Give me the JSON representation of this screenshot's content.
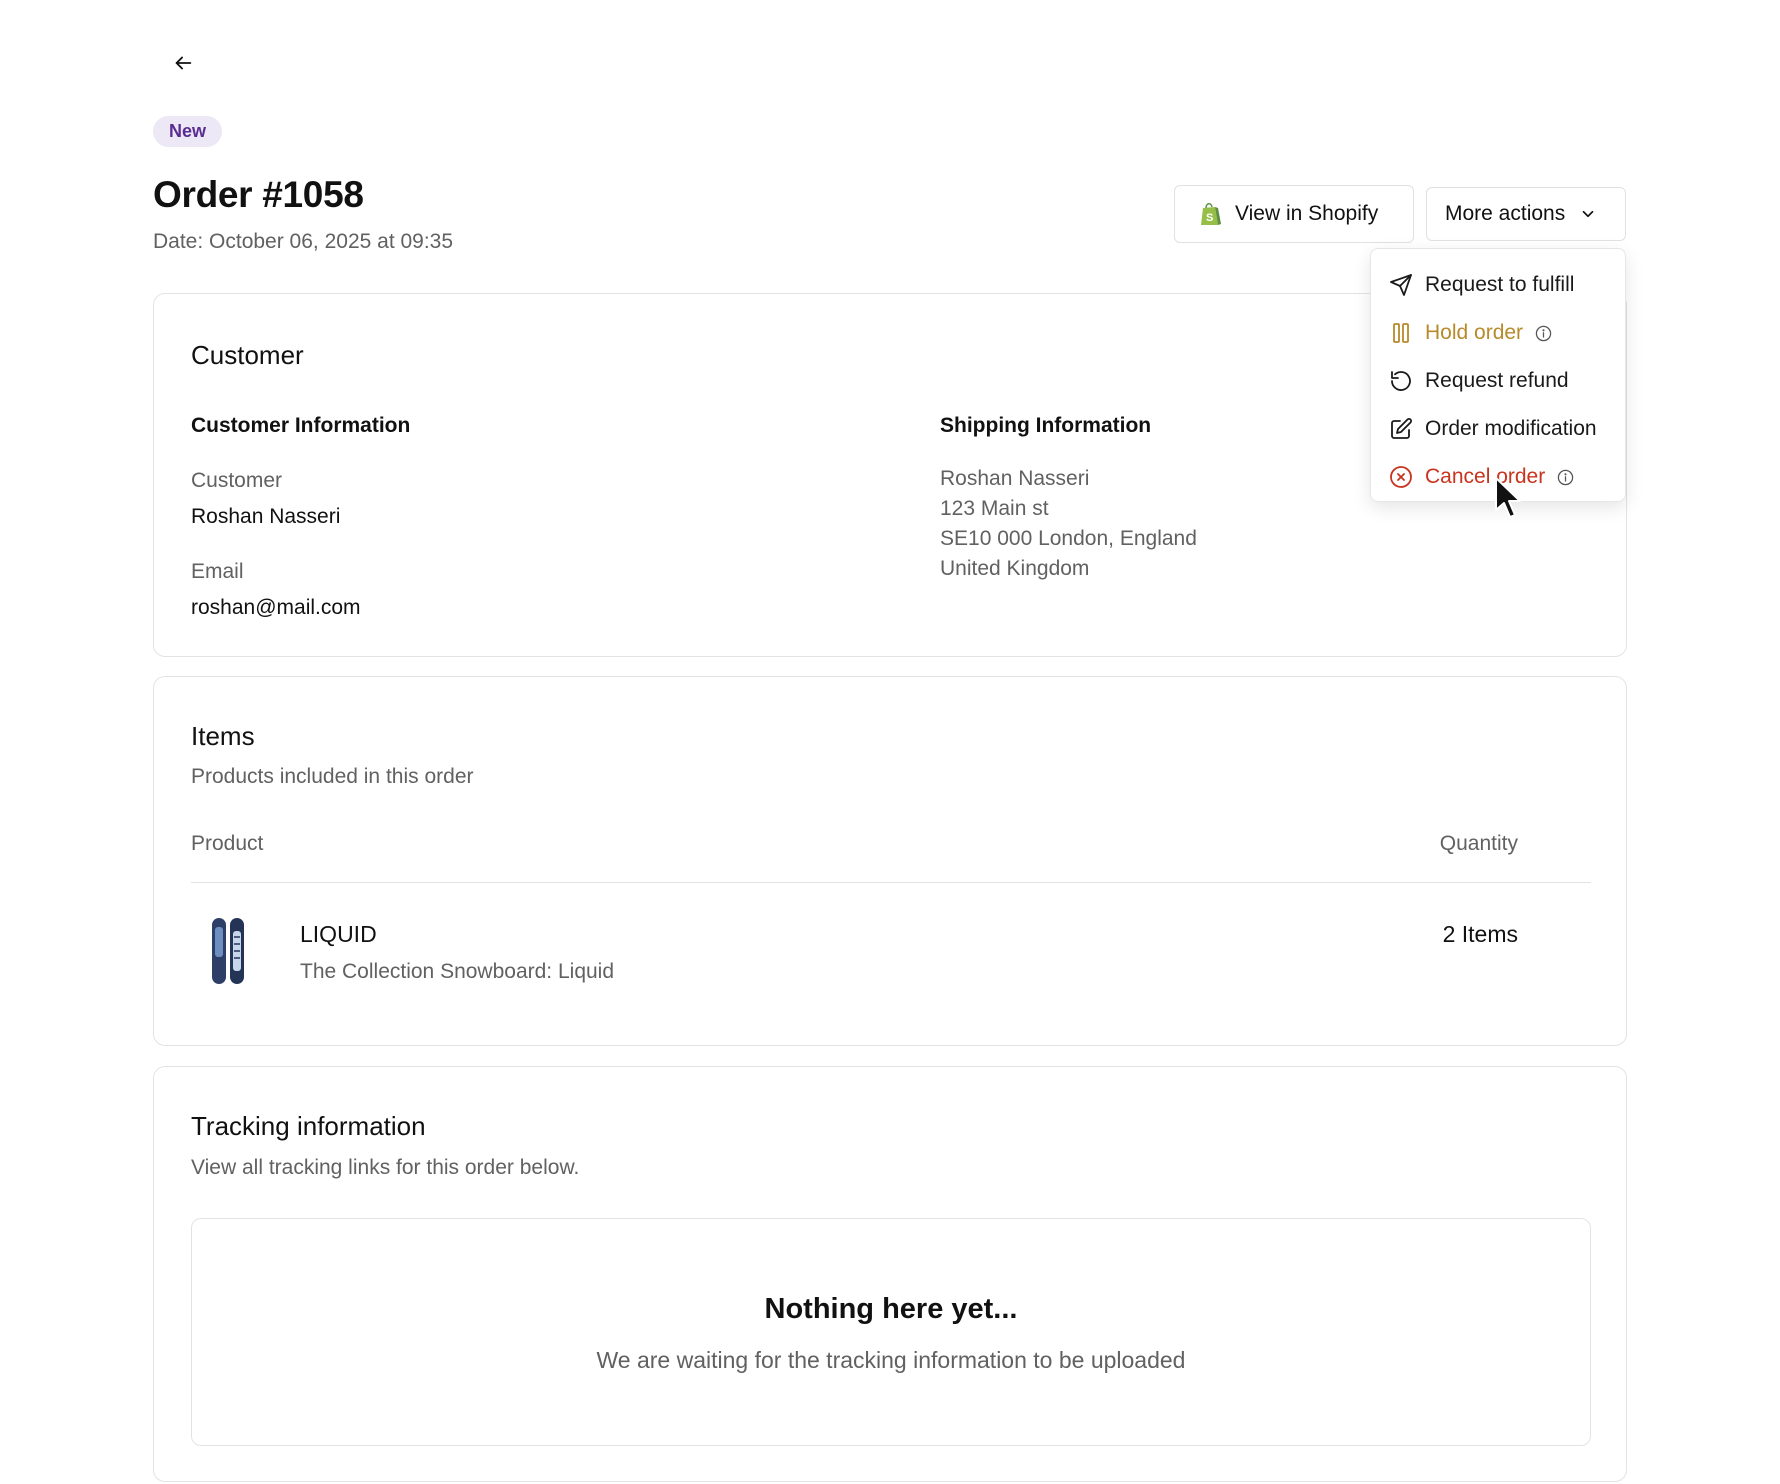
{
  "header": {
    "status_badge": "New",
    "order_title": "Order #1058",
    "order_date": "Date: October 06, 2025 at 09:35"
  },
  "actions": {
    "view_shopify_label": "View in Shopify",
    "more_actions_label": "More actions"
  },
  "menu": {
    "items": [
      {
        "label": "Request to fulfill",
        "icon": "send-icon"
      },
      {
        "label": "Hold order",
        "icon": "pause-icon",
        "color": "#b88a2a"
      },
      {
        "label": "Request refund",
        "icon": "refresh-icon"
      },
      {
        "label": "Order modification",
        "icon": "edit-icon"
      },
      {
        "label": "Cancel order",
        "icon": "x-circle-icon",
        "color": "#c8341e"
      }
    ]
  },
  "customer_card": {
    "title": "Customer",
    "customer_info_heading": "Customer Information",
    "customer_label": "Customer",
    "customer_name": "Roshan Nasseri",
    "email_label": "Email",
    "email": "roshan@mail.com",
    "shipping_heading": "Shipping Information",
    "shipping_lines": [
      "Roshan Nasseri",
      "123 Main st",
      "SE10 000 London, England",
      "United Kingdom"
    ]
  },
  "items_card": {
    "title": "Items",
    "subtitle": "Products included in this order",
    "col_product": "Product",
    "col_quantity": "Quantity",
    "rows": [
      {
        "name": "LIQUID",
        "description": "The Collection Snowboard: Liquid",
        "quantity": "2 Items"
      }
    ]
  },
  "tracking_card": {
    "title": "Tracking information",
    "subtitle": "View all tracking links for this order below.",
    "empty_title": "Nothing here yet...",
    "empty_subtitle": "We are waiting for the tracking information to be uploaded"
  },
  "colors": {
    "badge_bg": "#ece8f6",
    "badge_text": "#5a2d91",
    "hold": "#b88a2a",
    "cancel": "#c8341e"
  }
}
